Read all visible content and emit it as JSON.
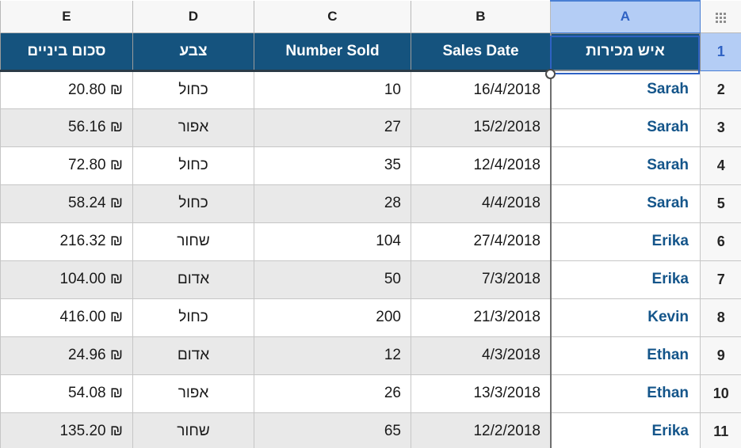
{
  "app": {
    "type": "spreadsheet",
    "corner_icon": "grid-dots-icon"
  },
  "colors": {
    "header_navy": "#15537E",
    "name_blue": "#14558A",
    "selection_blue": "#2F62C4",
    "selected_header_fill": "#B4CDF5",
    "band_gray": "#E9E9E9"
  },
  "columns": {
    "letters": [
      "E",
      "D",
      "C",
      "B",
      "A"
    ],
    "selected_letter": "A"
  },
  "row_numbers": [
    "1",
    "2",
    "3",
    "4",
    "5",
    "6",
    "7",
    "8",
    "9",
    "10",
    "11"
  ],
  "selected_row_number": "1",
  "table_headers": {
    "E": "סכום ביניים",
    "D": "צבע",
    "C": "Number Sold",
    "B": "Sales Date",
    "A": "איש מכירות"
  },
  "selected_cell": {
    "reference": "A1",
    "value": "איש מכירות"
  },
  "rows": [
    {
      "n": "2",
      "E": "20.80 ₪",
      "D": "כחול",
      "C": "10",
      "B": "16/4/2018",
      "A": "Sarah"
    },
    {
      "n": "3",
      "E": "56.16 ₪",
      "D": "אפור",
      "C": "27",
      "B": "15/2/2018",
      "A": "Sarah"
    },
    {
      "n": "4",
      "E": "72.80 ₪",
      "D": "כחול",
      "C": "35",
      "B": "12/4/2018",
      "A": "Sarah"
    },
    {
      "n": "5",
      "E": "58.24 ₪",
      "D": "כחול",
      "C": "28",
      "B": "4/4/2018",
      "A": "Sarah"
    },
    {
      "n": "6",
      "E": "216.32 ₪",
      "D": "שחור",
      "C": "104",
      "B": "27/4/2018",
      "A": "Erika"
    },
    {
      "n": "7",
      "E": "104.00 ₪",
      "D": "אדום",
      "C": "50",
      "B": "7/3/2018",
      "A": "Erika"
    },
    {
      "n": "8",
      "E": "416.00 ₪",
      "D": "כחול",
      "C": "200",
      "B": "21/3/2018",
      "A": "Kevin"
    },
    {
      "n": "9",
      "E": "24.96 ₪",
      "D": "אדום",
      "C": "12",
      "B": "4/3/2018",
      "A": "Ethan"
    },
    {
      "n": "10",
      "E": "54.08 ₪",
      "D": "אפור",
      "C": "26",
      "B": "13/3/2018",
      "A": "Ethan"
    },
    {
      "n": "11",
      "E": "135.20 ₪",
      "D": "שחור",
      "C": "65",
      "B": "12/2/2018",
      "A": "Erika"
    }
  ]
}
